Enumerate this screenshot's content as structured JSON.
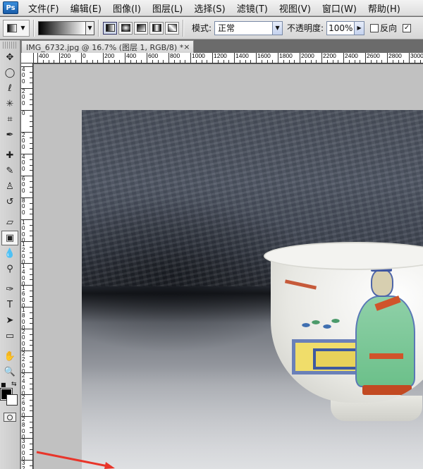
{
  "app": {
    "logo_text": "Ps"
  },
  "menu": [
    "文件(F)",
    "编辑(E)",
    "图像(I)",
    "图层(L)",
    "选择(S)",
    "滤镜(T)",
    "视图(V)",
    "窗口(W)",
    "帮助(H)"
  ],
  "options": {
    "mode_label": "模式:",
    "mode_value": "正常",
    "opacity_label": "不透明度:",
    "opacity_value": "100%",
    "reverse_label": "反向",
    "reverse_checked": false,
    "dither_checked": true
  },
  "document": {
    "tab_title": "IMG_6732.jpg @ 16.7% (图层 1, RGB/8) *",
    "close_glyph": "×"
  },
  "rulers": {
    "h_labels": [
      "400",
      "200",
      "0",
      "200",
      "400",
      "600",
      "800",
      "1000",
      "1200",
      "1400",
      "1600",
      "1800",
      "2000",
      "2200",
      "2400",
      "2600",
      "2800",
      "3000"
    ],
    "v_labels": [
      "4 0 0",
      "2 0 0",
      "0",
      "2 0 0",
      "4 0 0",
      "6 0 0",
      "8 0 0",
      "1 0 0 0",
      "1 2 0 0",
      "1 4 0 0",
      "1 6 0 0",
      "1 8 0 0",
      "2 0 0 0",
      "2 2 0 0",
      "2 4 0 0",
      "2 6 0 0",
      "2 8 0 0",
      "3 0 0 0",
      "3 2"
    ]
  },
  "tools": [
    {
      "name": "move-tool-icon",
      "glyph": "✥"
    },
    {
      "name": "marquee-tool-icon",
      "glyph": "◯"
    },
    {
      "name": "lasso-tool-icon",
      "glyph": "ℓ"
    },
    {
      "name": "magic-wand-tool-icon",
      "glyph": "✳"
    },
    {
      "name": "crop-tool-icon",
      "glyph": "⌗"
    },
    {
      "name": "eyedropper-tool-icon",
      "glyph": "✒"
    },
    {
      "name": "healing-brush-tool-icon",
      "glyph": "✚"
    },
    {
      "name": "brush-tool-icon",
      "glyph": "✎"
    },
    {
      "name": "clone-stamp-tool-icon",
      "glyph": "♙"
    },
    {
      "name": "history-brush-tool-icon",
      "glyph": "↺"
    },
    {
      "name": "eraser-tool-icon",
      "glyph": "▱"
    },
    {
      "name": "gradient-tool-icon",
      "glyph": "▣"
    },
    {
      "name": "blur-tool-icon",
      "glyph": "💧"
    },
    {
      "name": "dodge-tool-icon",
      "glyph": "⚲"
    },
    {
      "name": "pen-tool-icon",
      "glyph": "✑"
    },
    {
      "name": "type-tool-icon",
      "glyph": "T"
    },
    {
      "name": "path-selection-tool-icon",
      "glyph": "➤"
    },
    {
      "name": "shape-tool-icon",
      "glyph": "▭"
    },
    {
      "name": "hand-tool-icon",
      "glyph": "✋"
    },
    {
      "name": "zoom-tool-icon",
      "glyph": "🔍"
    }
  ],
  "colors": {
    "foreground": "#000000",
    "background": "#ffffff",
    "annotation": "#e8352a"
  }
}
